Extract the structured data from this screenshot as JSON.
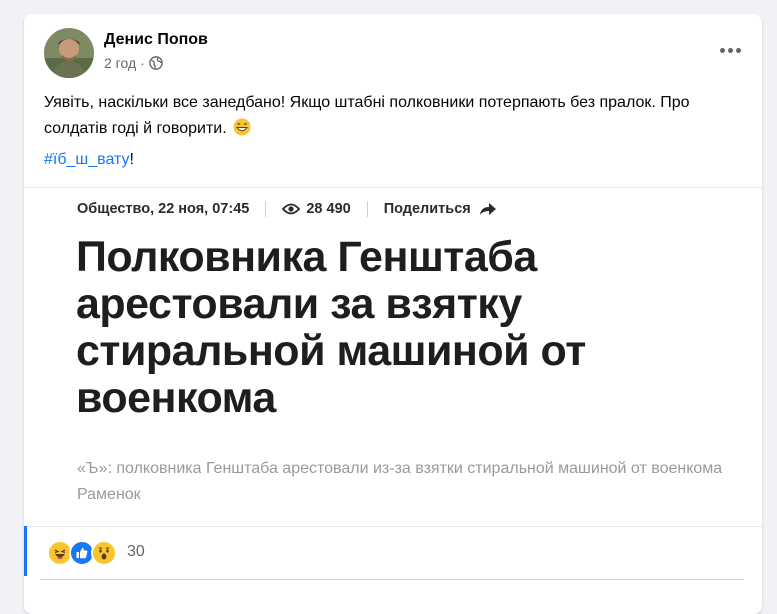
{
  "post": {
    "author": "Денис Попов",
    "time": "2 год",
    "separator": "·",
    "audience_icon": "globe-icon",
    "text": "Уявіть, наскільки все занедбано! Якщо штабні полковники потерпають без пралок. Про солдатів годі й говорити.",
    "emoji": "grinning-face-with-sweat",
    "hashtag": "#їб_ш_вату",
    "hashtag_suffix": "!",
    "more_icon": "more-options-icon"
  },
  "article": {
    "category_date": "Общество, 22 ноя, 07:45",
    "views": "28 490",
    "share_label": "Поделиться",
    "title": "Полковника Генштаба арестовали за взятку стиральной машиной от военкома",
    "lead": "«Ъ»: полковника Генштаба арестовали из-за взятки стиральной машиной от военкома Раменок"
  },
  "reactions": {
    "types": [
      "haha",
      "like",
      "wow"
    ],
    "count": "30"
  },
  "colors": {
    "accent": "#1877f2",
    "secondary_text": "#65676b",
    "like_blue": "#1877f2",
    "emoji_yellow": "#f7b125"
  }
}
